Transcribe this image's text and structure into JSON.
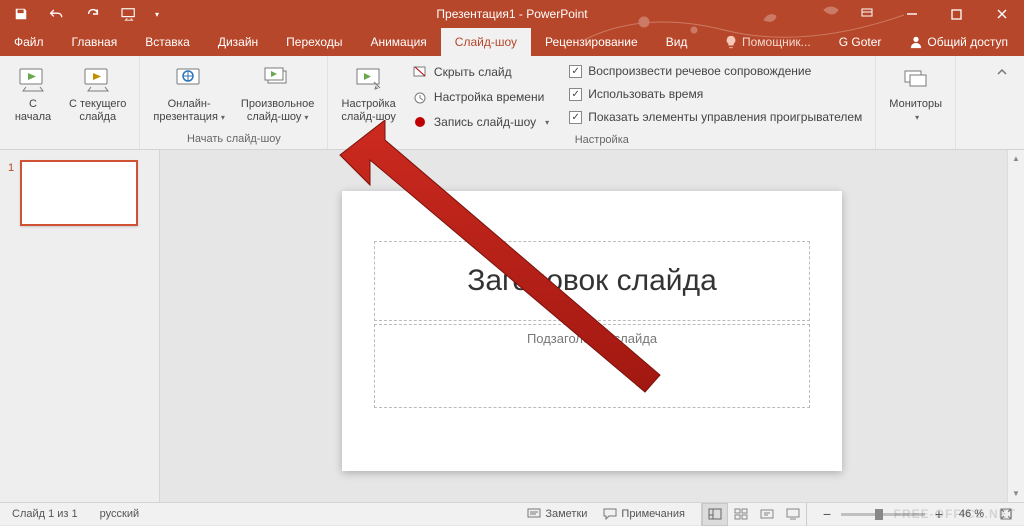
{
  "app": {
    "title": "Презентация1 - PowerPoint"
  },
  "tabs": {
    "file": "Файл",
    "home": "Главная",
    "insert": "Вставка",
    "design": "Дизайн",
    "transitions": "Переходы",
    "animations": "Анимация",
    "slideshow": "Слайд-шоу",
    "review": "Рецензирование",
    "view": "Вид",
    "tellme": "Помощник...",
    "user": "G Goter",
    "share": "Общий доступ"
  },
  "ribbon": {
    "start": {
      "from_beginning_l1": "С",
      "from_beginning_l2": "начала",
      "from_current_l1": "С текущего",
      "from_current_l2": "слайда",
      "online_l1": "Онлайн-",
      "online_l2": "презентация",
      "custom_l1": "Произвольное",
      "custom_l2": "слайд-шоу",
      "group_label": "Начать слайд-шоу"
    },
    "setup": {
      "setup_l1": "Настройка",
      "setup_l2": "слайд-шоу",
      "hide": "Скрыть слайд",
      "rehearse": "Настройка времени",
      "record": "Запись слайд-шоу",
      "play_narrations": "Воспроизвести речевое сопровождение",
      "use_timings": "Использовать время",
      "show_controls": "Показать элементы управления проигрывателем",
      "group_label": "Настройка"
    },
    "monitors": {
      "label": "Мониторы"
    }
  },
  "slide": {
    "number": "1",
    "title": "Заголовок слайда",
    "subtitle": "Подзаголовок слайда"
  },
  "status": {
    "slide_info": "Слайд 1 из 1",
    "language": "русский",
    "notes": "Заметки",
    "comments": "Примечания",
    "zoom": "46 %"
  },
  "watermark": "FREE-OFFICE.NET"
}
